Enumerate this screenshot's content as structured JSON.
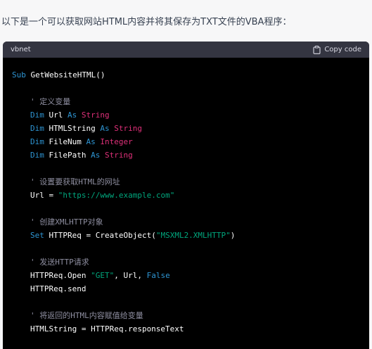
{
  "intro_text": "以下是一个可以获取网站HTML内容并将其保存为TXT文件的VBA程序：",
  "code_header": {
    "language": "vbnet",
    "copy_label": "Copy code",
    "copy_icon": "clipboard-icon"
  },
  "code": {
    "sub_keyword": "Sub",
    "sub_name": " GetWebsiteHTML()",
    "decl_comment": "' 定义变量",
    "dim": "Dim",
    "as": "As",
    "url_var": " Url ",
    "string_type": " String",
    "htmlstring_var": " HTMLString ",
    "filenum_var": " FileNum ",
    "integer_type": " Integer",
    "filepath_var": " FilePath ",
    "url_comment": "' 设置要获取HTML的网址",
    "url_assign": "Url = ",
    "url_value": "\"https://www.example.com\"",
    "obj_comment": "' 创建XMLHTTP对象",
    "set": "Set",
    "set_rest": " HTTPReq = CreateObject(",
    "progid": "\"MSXML2.XMLHTTP\"",
    "close_paren": ")",
    "req_comment": "' 发送HTTP请求",
    "open_call": "HTTPReq.Open ",
    "get_str": "\"GET\"",
    "open_args": ", Url, ",
    "false_kw": "False",
    "send_call": "HTTPReq.send",
    "resp_comment": "' 将返回的HTML内容赋值给变量",
    "resp_assign": "HTMLString = HTTPReq.responseText"
  },
  "colors": {
    "background": "#f7f7f8",
    "code_bg": "#000000",
    "header_bg": "#343541",
    "keyword": "#2e95d3",
    "type": "#df3079",
    "string": "#00a67d",
    "comment": "#8e8ea0"
  }
}
